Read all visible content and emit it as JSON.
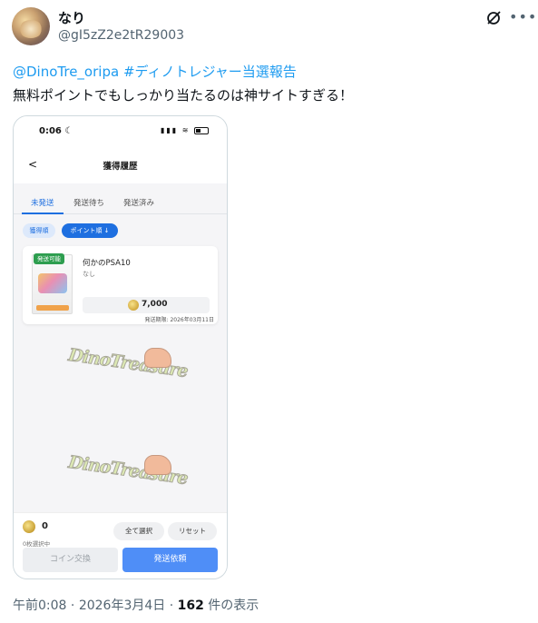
{
  "post": {
    "author_name": "なり",
    "author_handle": "@gI5zZ2e2tR29003",
    "mention": "@DinoTre_oripa",
    "hashtag": "#ディノトレジャー当選報告",
    "body": "無料ポイントでもしっかり当たるのは神サイトすぎる！",
    "time": "午前0:08",
    "separator": " · ",
    "date": "2026年3月4日",
    "views_count": "162",
    "views_label": " 件の表示",
    "more_icon": "•••",
    "icons": {
      "grok": "grok-icon",
      "more": "more-icon"
    }
  },
  "phone": {
    "status_time": "0:06",
    "status_moon": "☾",
    "status_icons": "▮▮▮ ≋",
    "back_icon": "<",
    "title": "獲得履歴",
    "tabs": [
      "未発送",
      "発送待ち",
      "発送済み"
    ],
    "active_tab": 0,
    "sort_chips": [
      "獲得順",
      "ポイント順 ↓"
    ],
    "item": {
      "badge": "発送可能",
      "title": "何かのPSA10",
      "subtitle": "なし",
      "points": "7,000",
      "deadline": "発送期限: 2026年03月11日"
    },
    "selected_count": "0",
    "selected_label": "0枚選択中",
    "select_all": "全て選択",
    "reset": "リセット",
    "coin_exchange": "コイン交換",
    "request_shipping": "発送依頼",
    "watermark_text": "DinoTreasure"
  },
  "colors": {
    "accent": "#1e6fe0",
    "link": "#1d9bf0",
    "badge_green": "#2e9e4f",
    "primary_button": "#4f8ef7"
  }
}
